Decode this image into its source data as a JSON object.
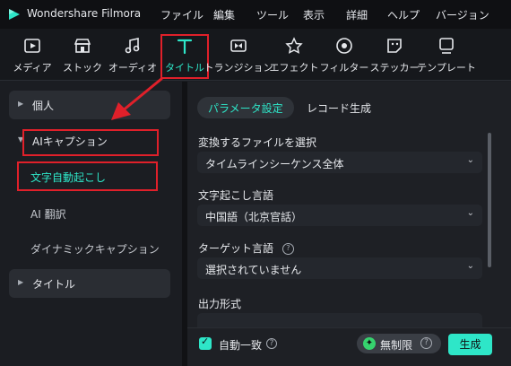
{
  "app": {
    "name": "Wondershare Filmora"
  },
  "menu": [
    "ファイル",
    "編集",
    "ツール",
    "表示",
    "詳細",
    "ヘルプ",
    "バージョン"
  ],
  "toolbar": {
    "items": [
      {
        "label": "メディア",
        "icon": "media-icon"
      },
      {
        "label": "ストック",
        "icon": "stock-icon"
      },
      {
        "label": "オーディオ",
        "icon": "audio-icon"
      },
      {
        "label": "タイトル",
        "icon": "title-icon",
        "active": true
      },
      {
        "label": "トランジション",
        "icon": "transition-icon"
      },
      {
        "label": "エフェクト",
        "icon": "effects-icon"
      },
      {
        "label": "フィルター",
        "icon": "filter-icon"
      },
      {
        "label": "ステッカー",
        "icon": "sticker-icon"
      },
      {
        "label": "テンプレート",
        "icon": "template-icon"
      }
    ]
  },
  "sidebar": {
    "personal": "個人",
    "ai_caption": "AIキャプション",
    "sub_items": [
      "文字自動起こし",
      "AI 翻訳",
      "ダイナミックキャプション"
    ],
    "title": "タイトル"
  },
  "tabs": [
    "パラメータ設定",
    "レコード生成"
  ],
  "form": {
    "file_label": "変換するファイルを選択",
    "file_value": "タイムラインシーケンス全体",
    "lang_label": "文字起こし言語",
    "lang_value": "中国語（北京官話）",
    "target_label": "ターゲット言語",
    "target_value": "選択されていません",
    "output_label": "出力形式"
  },
  "footer": {
    "auto_match": "自動一致",
    "unlimited": "無制限",
    "generate": "生成"
  },
  "colors": {
    "accent": "#2ee6c8",
    "highlight_box": "#e0202a"
  }
}
